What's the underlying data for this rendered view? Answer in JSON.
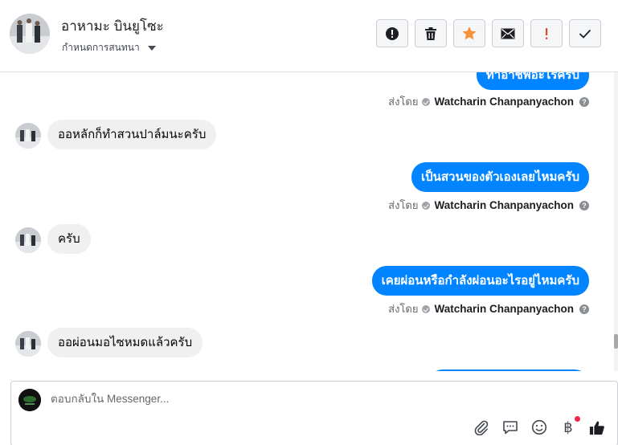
{
  "header": {
    "contact_name": "อาหามะ บินยูโซะ",
    "conversation_setting": "กำหนดการสนทนา"
  },
  "toolbar": {
    "buttons": [
      {
        "icon": "spam-alert-icon"
      },
      {
        "icon": "trash-icon"
      },
      {
        "icon": "star-icon",
        "color": "#f7923b"
      },
      {
        "icon": "envelope-icon"
      },
      {
        "icon": "exclamation-icon",
        "color": "#e0462a"
      },
      {
        "icon": "checkmark-icon"
      }
    ]
  },
  "messages": [
    {
      "dir": "out",
      "text": "ทำอาชีพอะไรครับ"
    },
    {
      "dir": "sent_by",
      "label": "ส่งโดย",
      "name": "Watcharin Chanpanyachon"
    },
    {
      "dir": "in",
      "text": "ออหลักก็ทำสวนปาล์มนะครับ"
    },
    {
      "dir": "out",
      "text": "เป็นสวนของตัวเองเลยไหมครับ"
    },
    {
      "dir": "sent_by",
      "label": "ส่งโดย",
      "name": "Watcharin Chanpanyachon"
    },
    {
      "dir": "in",
      "text": "ครับ"
    },
    {
      "dir": "out",
      "text": "เคยผ่อนหรือกำลังผ่อนอะไรอยู่ไหมครับ"
    },
    {
      "dir": "sent_by",
      "label": "ส่งโดย",
      "name": "Watcharin Chanpanyachon"
    },
    {
      "dir": "in",
      "text": "ออผ่อนมอไซหมดแล้วครับ"
    }
  ],
  "composer": {
    "placeholder": "ตอบกลับใน Messenger...",
    "actions": [
      "paperclip-icon",
      "chat-bubble-icon",
      "smiley-icon",
      "baht-icon",
      "thumbs-up-icon"
    ],
    "baht_symbol": "฿"
  },
  "colors": {
    "outgoing_bubble": "#0084ff",
    "incoming_bubble": "#f0f0f0"
  }
}
